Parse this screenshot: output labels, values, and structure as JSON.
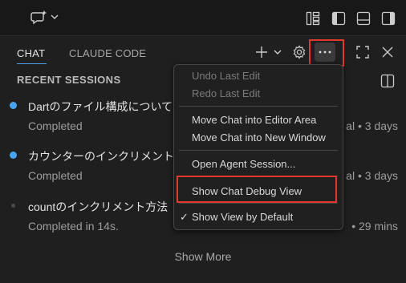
{
  "tabs": [
    {
      "label": "CHAT",
      "active": true
    },
    {
      "label": "CLAUDE CODE",
      "active": false
    }
  ],
  "section": {
    "title": "RECENT SESSIONS"
  },
  "sessions": [
    {
      "title": "Dartのファイル構成について",
      "status": "Completed",
      "meta": "al • 3 days",
      "dot_color": "#4aa3f0"
    },
    {
      "title": "カウンターのインクリメント",
      "status": "Completed",
      "meta": "al • 3 days",
      "dot_color": "#4aa3f0"
    },
    {
      "title": "countのインクリメント方法",
      "status": "Completed in 14s.",
      "meta": "• 29 mins",
      "dot_color": "#4a4a4a"
    }
  ],
  "show_more": "Show More",
  "menu": {
    "items": [
      {
        "label": "Undo Last Edit",
        "enabled": false
      },
      {
        "label": "Redo Last Edit",
        "enabled": false
      },
      {
        "label": "Move Chat into Editor Area",
        "enabled": true
      },
      {
        "label": "Move Chat into New Window",
        "enabled": true
      },
      {
        "label": "Open Agent Session...",
        "enabled": true
      },
      {
        "label": "Show Chat Debug View",
        "enabled": true,
        "highlighted": true
      },
      {
        "label": "Show View by Default",
        "enabled": true,
        "checked": true
      }
    ],
    "check_mark": "✓"
  },
  "colors": {
    "accent": "#4d9de0",
    "highlight_box": "#e03a2f"
  },
  "icons": [
    "chat-sparkle-icon",
    "chevron-down-icon",
    "layout-customize-icon",
    "toggle-primary-sidebar-icon",
    "toggle-panel-icon",
    "toggle-secondary-sidebar-icon",
    "plus-icon",
    "gear-icon",
    "more-actions-icon",
    "maximize-icon",
    "close-icon",
    "sidebar-toggle-icon"
  ]
}
